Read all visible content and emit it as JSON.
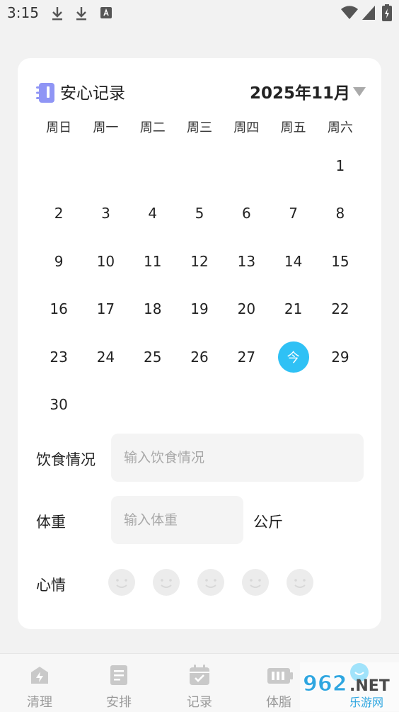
{
  "status_bar": {
    "time": "3:15"
  },
  "header": {
    "title": "安心记录",
    "month": "2025年11月"
  },
  "calendar": {
    "weekdays": [
      "周日",
      "周一",
      "周二",
      "周三",
      "周四",
      "周五",
      "周六"
    ],
    "leading_blanks": 6,
    "days": [
      "1",
      "2",
      "3",
      "4",
      "5",
      "6",
      "7",
      "8",
      "9",
      "10",
      "11",
      "12",
      "13",
      "14",
      "15",
      "16",
      "17",
      "18",
      "19",
      "20",
      "21",
      "22",
      "23",
      "24",
      "25",
      "26",
      "27",
      "今",
      "29",
      "30"
    ],
    "today_label": "今"
  },
  "form": {
    "diet_label": "饮食情况",
    "diet_placeholder": "输入饮食情况",
    "weight_label": "体重",
    "weight_placeholder": "输入体重",
    "weight_unit": "公斤",
    "mood_label": "心情"
  },
  "bottom_nav": {
    "items": [
      {
        "label": "清理",
        "icon": "cleanup-icon"
      },
      {
        "label": "安排",
        "icon": "document-icon"
      },
      {
        "label": "记录",
        "icon": "calendar-check-icon"
      },
      {
        "label": "体脂",
        "icon": "battery-icon"
      }
    ]
  },
  "watermark": {
    "text_top": "962.NET",
    "text_bottom": "乐游网"
  },
  "colors": {
    "accent": "#2fc1f5",
    "background": "#f2f2f2",
    "card": "#ffffff",
    "icon_purple": "#8f95f5"
  }
}
